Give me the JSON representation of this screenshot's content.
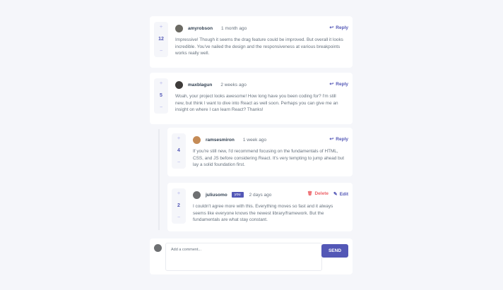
{
  "comments": [
    {
      "score": "12",
      "username": "amyrobson",
      "time": "1 month ago",
      "action": "Reply",
      "text": "Impressive! Though it seems the drag feature could be improved. But overall it looks incredible. You've nailed the design and the responsiveness at various breakpoints works really well.",
      "avatar_color": "#6b6a63"
    },
    {
      "score": "5",
      "username": "maxblagun",
      "time": "2 weeks ago",
      "action": "Reply",
      "text": "Woah, your project looks awesome! How long have you been coding for? I'm still new, but think I want to dive into React as well soon. Perhaps you can give me an insight on where I can learn React? Thanks!",
      "avatar_color": "#3e3b3a"
    }
  ],
  "replies": [
    {
      "score": "4",
      "username": "ramsesmiron",
      "time": "1 week ago",
      "action": "Reply",
      "text": "If you're still new, I'd recommend focusing on the fundamentals of HTML, CSS, and JS before considering React. It's very tempting to jump ahead but lay a solid foundation first.",
      "avatar_color": "#c58b56"
    },
    {
      "score": "2",
      "username": "juliusomo",
      "badge": "you",
      "time": "2 days ago",
      "delete_label": "Delete",
      "edit_label": "Edit",
      "text": "I couldn't agree more with this. Everything moves so fast and it always seems like everyone knows the newest library/framework. But the fundamentals are what stay constant.",
      "avatar_color": "#6e7072"
    }
  ],
  "composer": {
    "placeholder": "Add a comment...",
    "send_label": "SEND",
    "avatar_color": "#6e7072"
  },
  "icons": {
    "plus": "+",
    "minus": "−",
    "reply": "↩",
    "delete": "🗑",
    "edit": "✎"
  },
  "colors": {
    "primary": "#5357b6",
    "danger": "#ed6368",
    "background": "#f5f6fa"
  }
}
